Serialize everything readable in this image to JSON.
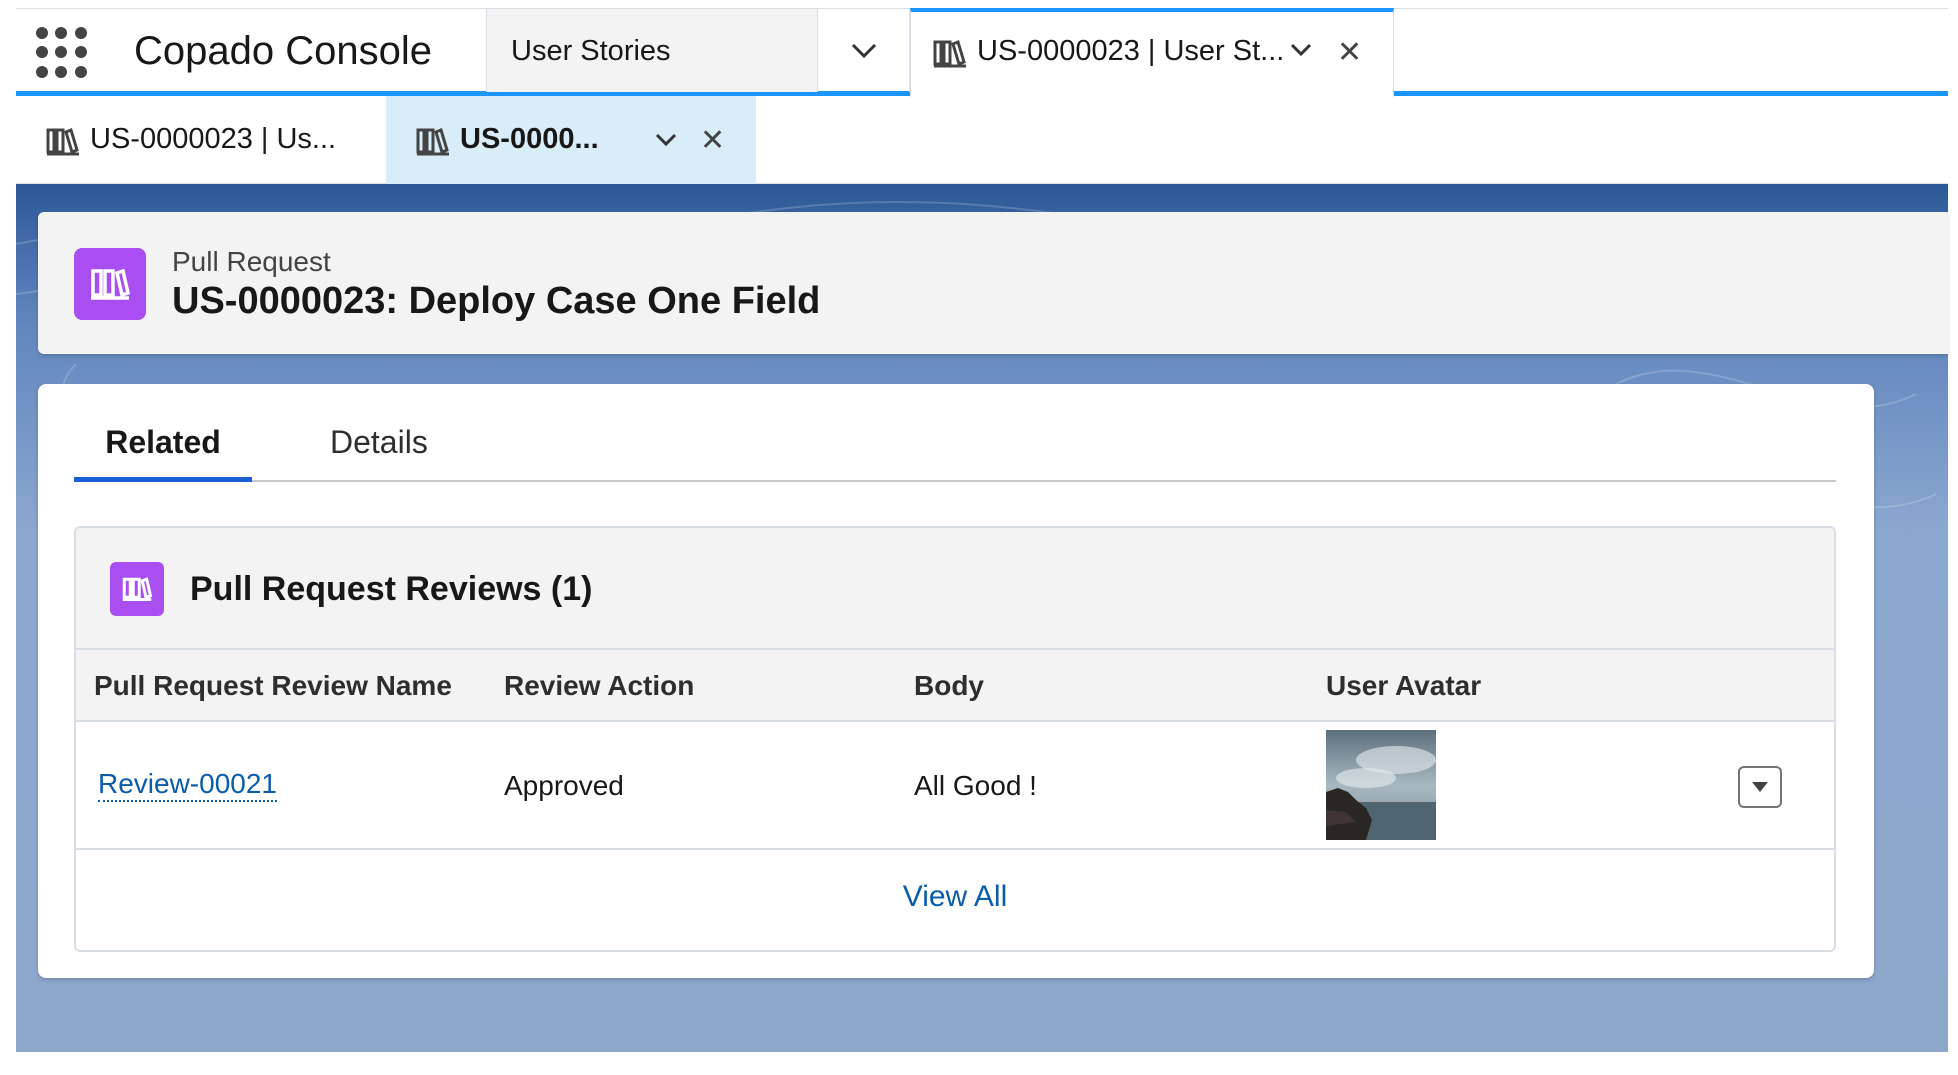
{
  "app": {
    "name": "Copado Console",
    "nav_selected": "User Stories",
    "workspace_tab_label": "US-0000023 | User St..."
  },
  "subtabs": [
    {
      "label": "US-0000023 | Us..."
    },
    {
      "label": "US-0000..."
    }
  ],
  "record": {
    "object_type": "Pull Request",
    "title": "US-0000023: Deploy Case One Field"
  },
  "tabs": {
    "related": "Related",
    "details": "Details"
  },
  "related_list": {
    "title": "Pull Request Reviews (1)",
    "columns": [
      "Pull Request Review Name",
      "Review Action",
      "Body",
      "User Avatar"
    ],
    "rows": [
      {
        "name": "Review-00021",
        "action": "Approved",
        "body": "All Good !"
      }
    ],
    "view_all": "View All"
  },
  "colors": {
    "accent": "#1b96ff",
    "record_icon": "#a94ef1",
    "link": "#0b5cab",
    "active_subtab": "#d8edf7"
  },
  "icons": {
    "app_launcher": "grid-icon",
    "tab_type": "book-icon",
    "chevron": "chevron-down-icon",
    "close": "close-icon",
    "row_action": "caret-down-icon"
  }
}
